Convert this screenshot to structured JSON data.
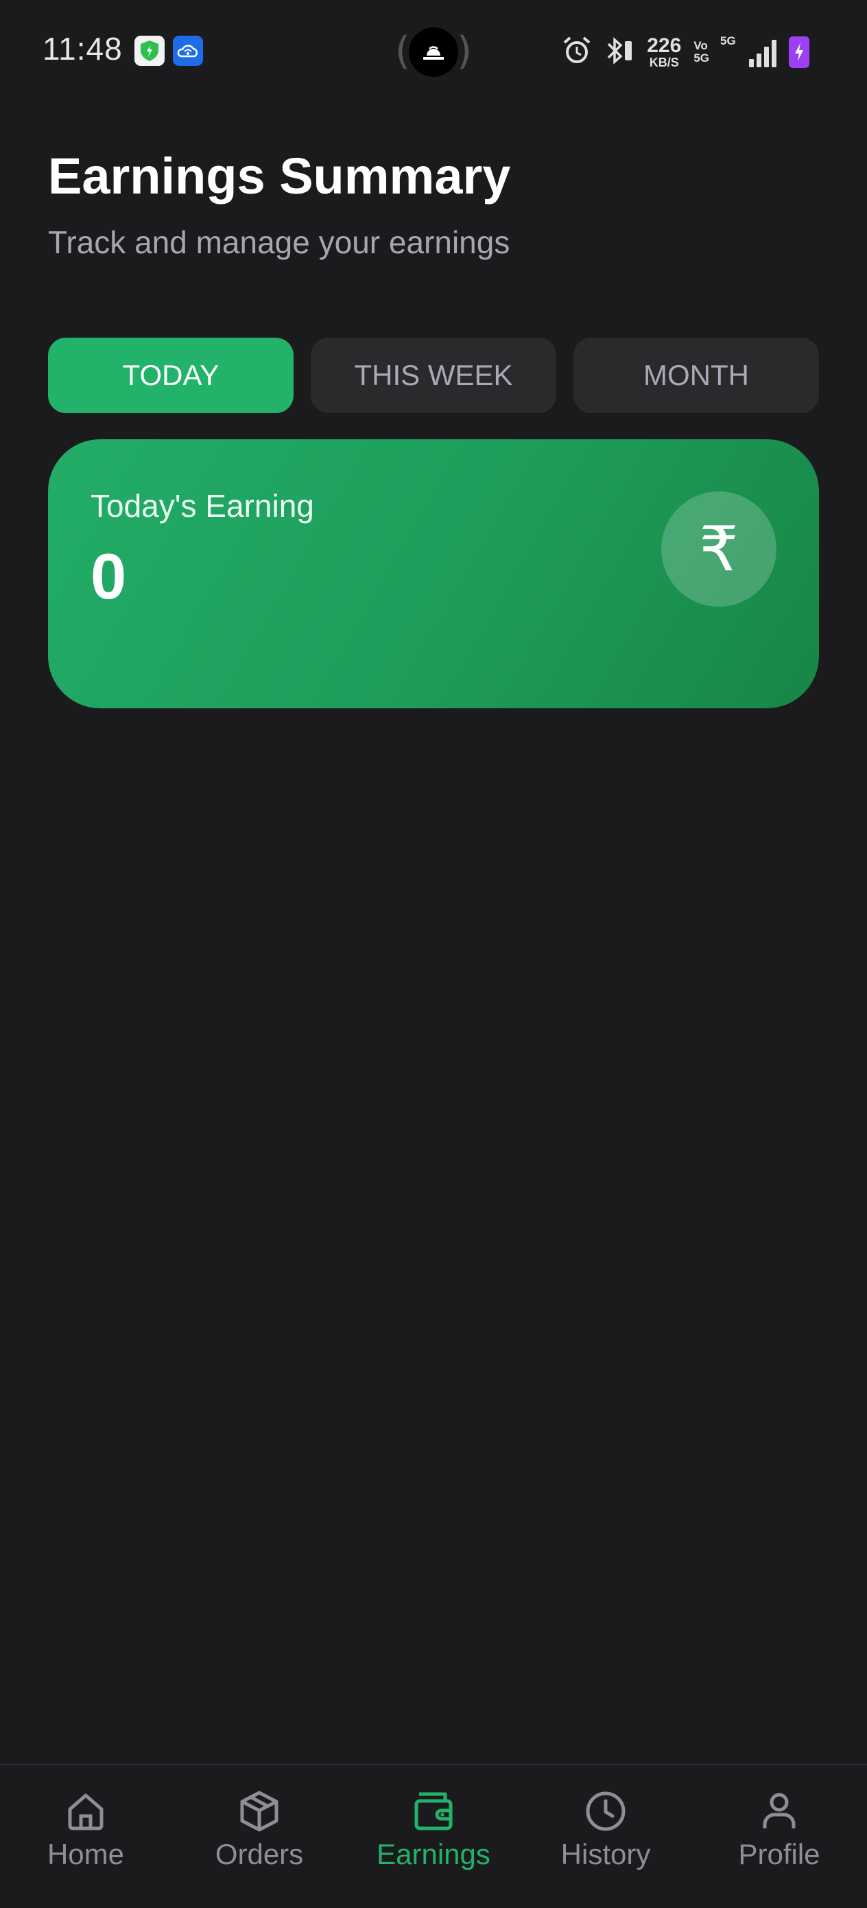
{
  "status_bar": {
    "time": "11:48",
    "net_speed_value": "226",
    "net_speed_unit": "KB/S",
    "volte_top": "Vo",
    "volte_bottom": "5G",
    "network_type": "5G"
  },
  "header": {
    "title": "Earnings Summary",
    "subtitle": "Track and manage your earnings"
  },
  "tabs": [
    {
      "label": "TODAY",
      "active": true
    },
    {
      "label": "THIS WEEK",
      "active": false
    },
    {
      "label": "MONTH",
      "active": false
    }
  ],
  "earning_card": {
    "label": "Today's Earning",
    "value": "0",
    "currency_symbol": "₹"
  },
  "bottom_nav": {
    "items": [
      {
        "label": "Home",
        "icon": "home-icon",
        "active": false
      },
      {
        "label": "Orders",
        "icon": "box-icon",
        "active": false
      },
      {
        "label": "Earnings",
        "icon": "wallet-icon",
        "active": true
      },
      {
        "label": "History",
        "icon": "clock-icon",
        "active": false
      },
      {
        "label": "Profile",
        "icon": "user-icon",
        "active": false
      }
    ]
  },
  "colors": {
    "background": "#1b1b1d",
    "accent": "#22b26a",
    "tab_inactive_bg": "#2a2a2d",
    "tab_inactive_text": "#a9aab7",
    "nav_inactive": "#8e8e94"
  }
}
